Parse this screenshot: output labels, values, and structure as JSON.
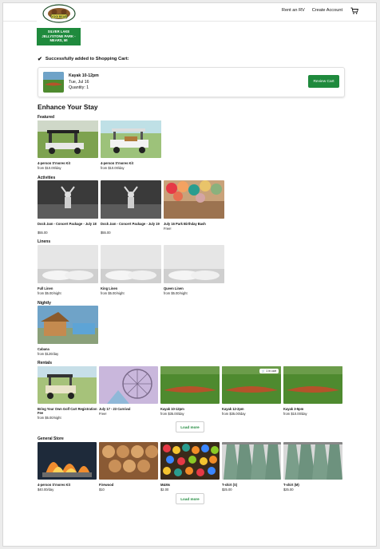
{
  "header": {
    "logo_text": "SILVER LAKE JELLYSTONE PARK - MEARS, MI",
    "nav": [
      "Rent an RV",
      "Create Account"
    ],
    "cart_icon": "shopping-cart-icon"
  },
  "success": {
    "message": "Successfully added to Shopping Cart:",
    "item": {
      "title": "Kayak 10-12pm",
      "date": "Tue, Jul 16",
      "quantity": "Quantity: 1"
    },
    "review_button": "Review Cart"
  },
  "enhance_title": "Enhance Your Stay",
  "sections": {
    "featured": {
      "label": "Featured",
      "items": [
        {
          "title": "4-person S'mores Kit",
          "price": "from $10.00/day"
        },
        {
          "title": "4-person S'mores Kit",
          "price": "from $10.00/day"
        }
      ]
    },
    "activities": {
      "label": "Activities",
      "items": [
        {
          "title": "Dock Jam - Concert Package - July 18",
          "price": "$55.00"
        },
        {
          "title": "Dock Jam - Concert Package - July 19",
          "price": "$55.00"
        },
        {
          "title": "July 16 Park Birthday Bash",
          "price": "Free!"
        }
      ]
    },
    "linens": {
      "label": "Linens",
      "items": [
        {
          "title": "Full Linen",
          "price": "from $5.00/night"
        },
        {
          "title": "King Linen",
          "price": "from $5.00/night"
        },
        {
          "title": "Queen Linen",
          "price": "from $5.00/night"
        }
      ]
    },
    "nightly": {
      "label": "Nightly",
      "items": [
        {
          "title": "Cabana",
          "price": "from $120/day"
        }
      ]
    },
    "rentals": {
      "label": "Rentals",
      "items": [
        {
          "title": "Bring Your Own Golf Cart Registration Fee",
          "price": "from $5.00/night"
        },
        {
          "title": "July 17 - 23 Carnival",
          "price": "Free!"
        },
        {
          "title": "Kayak 10-12pm",
          "price": "from $35.00/day"
        },
        {
          "title": "Kayak 12-2pm",
          "price": "from $35.00/day",
          "badge": "1 in cart"
        },
        {
          "title": "Kayak 3-5pm",
          "price": "from $10.00/day"
        }
      ],
      "load_more": "Load more"
    },
    "general_store": {
      "label": "General Store",
      "items": [
        {
          "title": "4-person S'mores Kit",
          "price": "$40.00/day"
        },
        {
          "title": "Firewood",
          "price": "$10"
        },
        {
          "title": "M&Ms",
          "price": "$2.00"
        },
        {
          "title": "T-shirt (S)",
          "price": "$25.00"
        },
        {
          "title": "T-shirt (M)",
          "price": "$25.00"
        }
      ],
      "load_more": "Load more"
    }
  },
  "colors": {
    "brand_green": "#1f8a3d"
  }
}
